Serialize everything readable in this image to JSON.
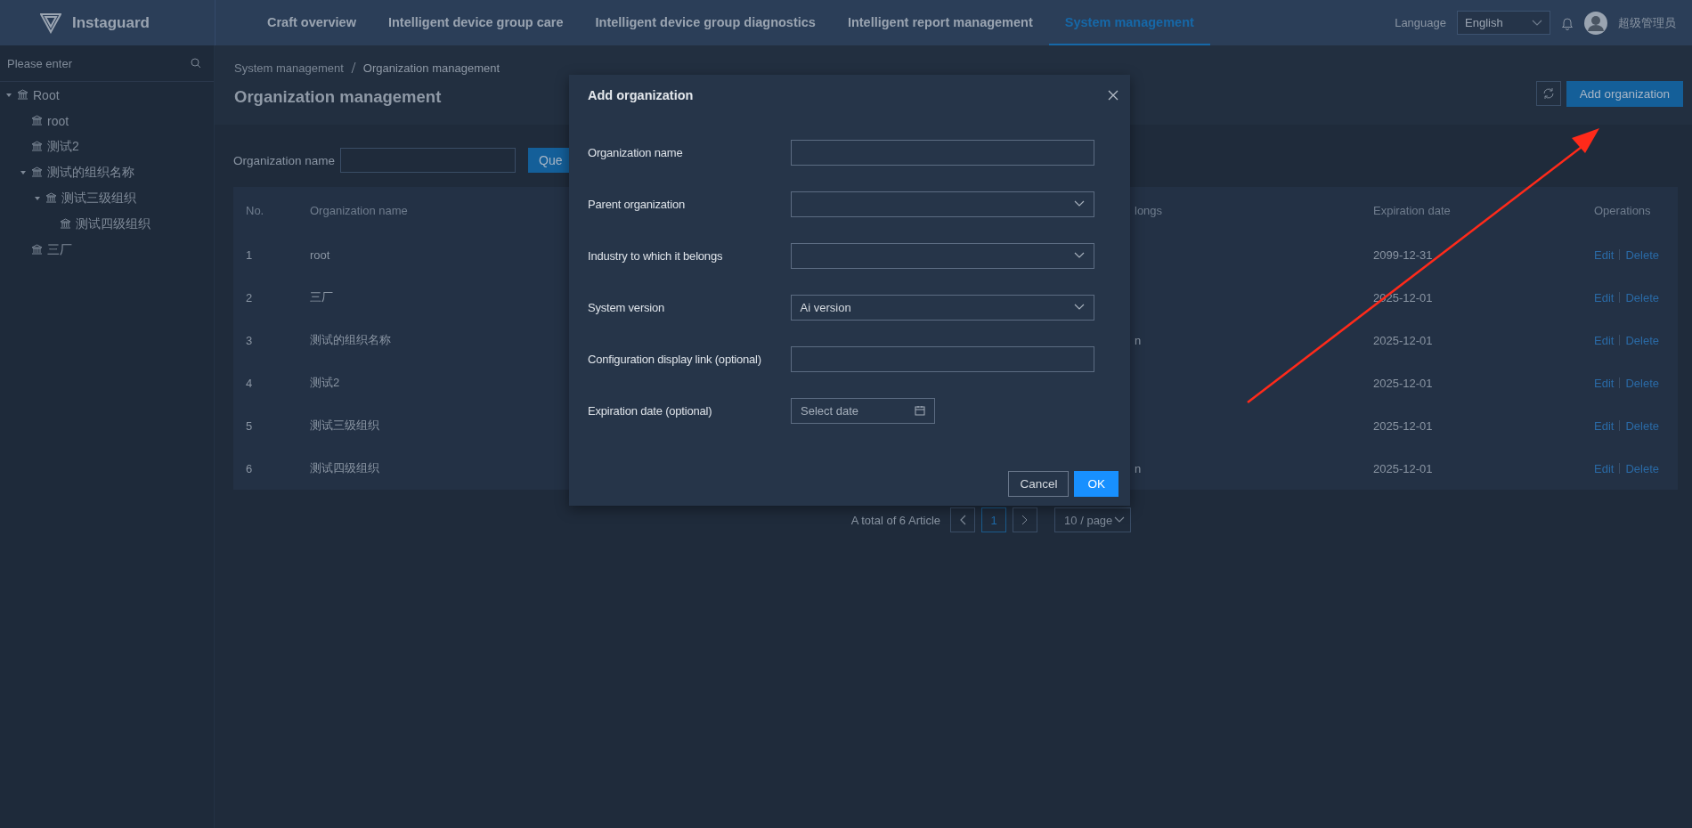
{
  "app": {
    "logo": "Instaguard"
  },
  "nav": [
    {
      "label": "Craft overview",
      "selected": false
    },
    {
      "label": "Intelligent device group care",
      "selected": false
    },
    {
      "label": "Intelligent device group diagnostics",
      "selected": false
    },
    {
      "label": "Intelligent report management",
      "selected": false
    },
    {
      "label": "System management",
      "selected": true
    }
  ],
  "language": {
    "label": "Language",
    "value": "English"
  },
  "user": {
    "name": "超级管理员"
  },
  "sidebar": {
    "placeholder": "Please enter",
    "tree": [
      {
        "label": "Root",
        "expanded": true,
        "children": [
          {
            "label": "root"
          },
          {
            "label": "测试2"
          },
          {
            "label": "测试的组织名称",
            "expanded": true,
            "children": [
              {
                "label": "测试三级组织",
                "expanded": true,
                "children": [
                  {
                    "label": "测试四级组织"
                  }
                ]
              }
            ]
          },
          {
            "label": "三厂"
          }
        ]
      }
    ]
  },
  "breadcrumb": [
    "System management",
    "Organization management"
  ],
  "page_title": "Organization management",
  "add_button": "Add organization",
  "filter": {
    "label": "Organization name",
    "button": "Que"
  },
  "table": {
    "columns": [
      "No.",
      "Organization name",
      "longs",
      "Expiration date",
      "Operations"
    ],
    "rows": [
      {
        "no": "1",
        "name": "root",
        "expiration": "2099-12-31",
        "actions": [
          "Edit",
          "Delete"
        ]
      },
      {
        "no": "2",
        "name": "三厂",
        "expiration": "2025-12-01",
        "actions": [
          "Edit",
          "Delete"
        ]
      },
      {
        "no": "3",
        "name": "测试的组织名称",
        "column_3": "n",
        "expiration": "2025-12-01",
        "actions": [
          "Edit",
          "Delete"
        ]
      },
      {
        "no": "4",
        "name": "测试2",
        "expiration": "2025-12-01",
        "actions": [
          "Edit",
          "Delete"
        ]
      },
      {
        "no": "5",
        "name": "测试三级组织",
        "expiration": "2025-12-01",
        "actions": [
          "Edit",
          "Delete"
        ]
      },
      {
        "no": "6",
        "name": "测试四级组织",
        "column_3": "n",
        "expiration": "2025-12-01",
        "actions": [
          "Edit",
          "Delete"
        ]
      }
    ]
  },
  "pagination": {
    "total": "A total of 6 Article",
    "pages": [
      {
        "label": "1",
        "selected": true
      }
    ],
    "page_size": "10 / page"
  },
  "dialog": {
    "title": "Add organization",
    "fields": [
      {
        "kind": "text",
        "label": "Organization name"
      },
      {
        "kind": "select",
        "label": "Parent organization"
      },
      {
        "kind": "select",
        "label": "Industry to which it belongs"
      },
      {
        "kind": "select",
        "label": "System version",
        "value": "Ai version"
      },
      {
        "kind": "text",
        "label": "Configuration display link (optional)"
      },
      {
        "kind": "date",
        "label": "Expiration date (optional)",
        "placeholder": "Select date"
      }
    ],
    "buttons": [
      {
        "label": "Cancel",
        "kind": "default"
      },
      {
        "label": "OK",
        "kind": "primary"
      }
    ]
  }
}
